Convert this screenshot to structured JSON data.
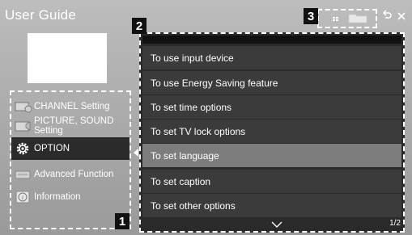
{
  "window": {
    "title": "User Guide"
  },
  "callouts": {
    "one": "1",
    "two": "2",
    "three": "3"
  },
  "left_menu": {
    "items": [
      {
        "label": "CHANNEL Setting",
        "icon": "channel-icon",
        "active": false
      },
      {
        "label": "PICTURE, SOUND Setting",
        "icon": "picture-sound-icon",
        "active": false
      },
      {
        "label": "OPTION",
        "icon": "gear-icon",
        "active": true
      },
      {
        "label": "Advanced Function",
        "icon": "advanced-function-icon",
        "active": false
      },
      {
        "label": "Information",
        "icon": "info-icon",
        "active": false
      }
    ]
  },
  "content_list": {
    "items": [
      {
        "label": "To use input device",
        "selected": false
      },
      {
        "label": "To use Energy Saving feature",
        "selected": false
      },
      {
        "label": "To set time options",
        "selected": false
      },
      {
        "label": "To set TV lock options",
        "selected": false
      },
      {
        "label": "To set language",
        "selected": true
      },
      {
        "label": "To set caption",
        "selected": false
      },
      {
        "label": "To set other options",
        "selected": false
      }
    ],
    "page_indicator": "1/2"
  },
  "toolbar": {
    "icons": [
      "grid-view-icon",
      "folder-icon"
    ],
    "back_icon": "back-icon",
    "close_icon": "close-icon"
  },
  "colors": {
    "background": "#a9a9a9",
    "panel": "#3b3b3b",
    "selected": "#7d7d7d",
    "active_menu": "#2b2b2b",
    "callout": "#111111"
  }
}
